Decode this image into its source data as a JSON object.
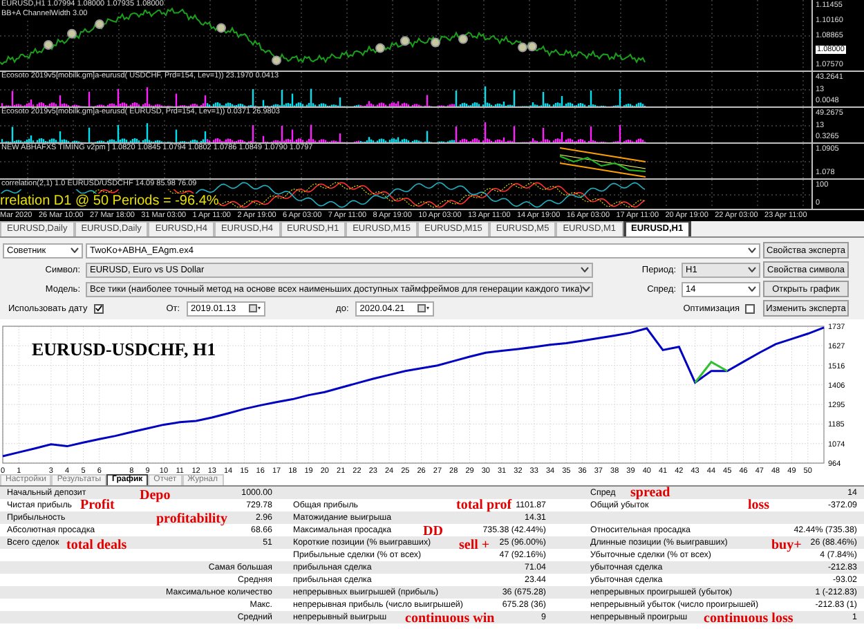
{
  "chart_window": {
    "panes": [
      {
        "kind": "price",
        "labels": [
          "EURUSD,H1  1.07994 1.08000 1.07935 1.08000",
          "BB+A ChannelWidth 3.00"
        ],
        "axis": [
          {
            "text": "1.11455",
            "kind": "tick"
          },
          {
            "text": "1.10160",
            "kind": "tick"
          },
          {
            "text": "1.08865",
            "kind": "tick"
          },
          {
            "text": "1.08000",
            "kind": "current"
          },
          {
            "text": "1.07570",
            "kind": "tick"
          }
        ]
      },
      {
        "kind": "histogram",
        "labels": [
          "Ecosoto 2019v5[mobilk.gm]a-eurusd( USDCHF, Prd=154, Lev=1)) 23.1970 0.0413"
        ],
        "axis": [
          {
            "text": "43.2641",
            "kind": "tick"
          },
          {
            "text": "13",
            "kind": "tick"
          },
          {
            "text": "0.0048",
            "kind": "tick"
          }
        ]
      },
      {
        "kind": "histogram_inverse",
        "labels": [
          "Ecosoto 2019v5[mobilk.gm]a-eurusd( EURUSD, Prd=154, Lev=1)) 0.0371 26.9803"
        ],
        "axis": [
          {
            "text": "49.2675",
            "kind": "tick"
          },
          {
            "text": "13",
            "kind": "tick"
          },
          {
            "text": "0.3265",
            "kind": "tick"
          }
        ]
      },
      {
        "kind": "channel",
        "labels": [
          "NEW ABHAFXS TIMING v2pm ]  1.0820 1.0845 1.0794 1.0802 1.0786 1.0849 1.0790 1.0797"
        ],
        "axis": [
          {
            "text": "1.0905",
            "kind": "tick"
          },
          {
            "text": "1.078",
            "kind": "tick"
          }
        ]
      },
      {
        "kind": "correlation",
        "labels": [
          "correlation(2,1) 1.0 EURUSD/USDCHF 14.09 85.98 76.09"
        ],
        "overlay": "rrelation D1 @ 50 Periods = -96.4%",
        "axis": [
          {
            "text": "100",
            "kind": "tick"
          },
          {
            "text": "0",
            "kind": "tick"
          }
        ]
      }
    ],
    "time_axis": [
      "Mar 2020",
      "26 Mar 10:00",
      "27 Mar 18:00",
      "31 Mar 03:00",
      "1 Apr 11:00",
      "2 Apr 19:00",
      "6 Apr 03:00",
      "7 Apr 11:00",
      "8 Apr 19:00",
      "10 Apr 03:00",
      "13 Apr 11:00",
      "14 Apr 19:00",
      "16 Apr 03:00",
      "17 Apr 11:00",
      "20 Apr 19:00",
      "22 Apr 03:00",
      "23 Apr 11:00"
    ]
  },
  "chart_tabs": [
    {
      "label": "EURUSD,Daily",
      "selected": false
    },
    {
      "label": "EURUSD,Daily",
      "selected": false
    },
    {
      "label": "EURUSD,H4",
      "selected": false
    },
    {
      "label": "EURUSD,H4",
      "selected": false
    },
    {
      "label": "EURUSD,H1",
      "selected": false
    },
    {
      "label": "EURUSD,M15",
      "selected": false
    },
    {
      "label": "EURUSD,M15",
      "selected": false
    },
    {
      "label": "EURUSD,M5",
      "selected": false
    },
    {
      "label": "EURUSD,M1",
      "selected": false
    },
    {
      "label": "EURUSD,H1",
      "selected": true
    }
  ],
  "tester": {
    "expert_type": "Советник",
    "expert": "TwoKo+ABHA_EAgm.ex4",
    "symbol_label": "Символ:",
    "symbol": "EURUSD, Euro vs US Dollar",
    "period_label": "Период:",
    "period": "H1",
    "model_label": "Модель:",
    "model": "Все тики (наиболее точный метод на основе всех наименьших доступных таймфреймов для генерации каждого тика)",
    "spread_label": "Спред:",
    "spread": "14",
    "use_date_label": "Использовать дату",
    "use_date": true,
    "from_label": "От:",
    "from": "2019.01.13",
    "to_label": "до:",
    "to": "2020.04.21",
    "optimization_label": "Оптимизация",
    "optimization": false,
    "buttons": [
      "Свойства эксперта",
      "Свойства символа",
      "Открыть график",
      "Изменить эксперта"
    ]
  },
  "equity_chart": {
    "chart_data": {
      "type": "line",
      "title": "EURUSD-USDCHF, H1",
      "x": [
        0,
        1,
        2,
        3,
        4,
        5,
        6,
        7,
        8,
        9,
        10,
        11,
        12,
        13,
        14,
        15,
        16,
        17,
        18,
        19,
        20,
        21,
        22,
        23,
        24,
        25,
        26,
        27,
        28,
        29,
        30,
        31,
        32,
        33,
        34,
        35,
        36,
        37,
        38,
        39,
        40,
        41,
        42,
        43,
        44,
        45,
        46,
        47,
        48,
        49,
        50,
        51
      ],
      "series": [
        {
          "color": "#0000c0",
          "values": [
            1003,
            1025,
            1047,
            1070,
            1059,
            1080,
            1100,
            1118,
            1140,
            1160,
            1181,
            1195,
            1202,
            1222,
            1245,
            1270,
            1290,
            1308,
            1325,
            1348,
            1365,
            1390,
            1415,
            1440,
            1462,
            1484,
            1500,
            1515,
            1540,
            1565,
            1588,
            1598,
            1608,
            1620,
            1632,
            1642,
            1655,
            1670,
            1685,
            1700,
            1725,
            1603,
            1621,
            1419,
            1484,
            1484,
            1536,
            1588,
            1636,
            1665,
            1695,
            1730
          ]
        },
        {
          "color": "#30c030",
          "values": [
            null,
            null,
            null,
            null,
            null,
            null,
            null,
            null,
            null,
            null,
            null,
            null,
            null,
            null,
            null,
            null,
            null,
            null,
            null,
            null,
            null,
            null,
            null,
            null,
            null,
            null,
            null,
            null,
            null,
            null,
            null,
            null,
            null,
            null,
            null,
            null,
            null,
            null,
            null,
            null,
            null,
            null,
            null,
            1419,
            1535,
            1484,
            null,
            null,
            null,
            null,
            null,
            null
          ]
        }
      ],
      "xticks": [
        0,
        1,
        3,
        4,
        5,
        6,
        8,
        9,
        10,
        11,
        12,
        13,
        14,
        15,
        16,
        17,
        18,
        19,
        20,
        21,
        22,
        23,
        24,
        25,
        26,
        27,
        28,
        29,
        30,
        31,
        32,
        33,
        34,
        35,
        36,
        37,
        38,
        39,
        40,
        41,
        42,
        43,
        44,
        45,
        46,
        47,
        48,
        49,
        50
      ],
      "yticks": [
        964,
        1074,
        1185,
        1295,
        1406,
        1516,
        1627,
        1737
      ],
      "grid": true,
      "ylim": [
        964,
        1737
      ],
      "xlim": [
        0,
        51
      ]
    }
  },
  "result_tabs": [
    {
      "label": "Настройки",
      "selected": false
    },
    {
      "label": "Результаты",
      "selected": false
    },
    {
      "label": "График",
      "selected": true
    },
    {
      "label": "Отчет",
      "selected": false
    },
    {
      "label": "Журнал",
      "selected": false
    }
  ],
  "report": {
    "rows": [
      {
        "col_1": "Начальный депозит",
        "col_2": "1000.00",
        "col_5": "Спред",
        "col_6": "14"
      },
      {
        "col_1": "Чистая прибыль",
        "col_2": "729.78",
        "col_3": "Общая прибыль",
        "col_4": "1101.87",
        "col_5": "Общий убыток",
        "col_6": "-372.09"
      },
      {
        "col_1": "Прибыльность",
        "col_2": "2.96",
        "col_3": "Матожидание выигрыша",
        "col_4": "14.31"
      },
      {
        "col_1": "Абсолютная просадка",
        "col_2": "68.66",
        "col_3": "Максимальная просадка",
        "col_4": "735.38 (42.44%)",
        "col_5": "Относительная просадка",
        "col_6": "42.44% (735.38)"
      },
      {
        "col_1": "Всего сделок",
        "col_2": "51",
        "col_3": "Короткие позиции (% выигравших)",
        "col_4": "25 (96.00%)",
        "col_5": "Длинные позиции (% выигравших)",
        "col_6": "26 (88.46%)"
      },
      {
        "col_3": "Прибыльные сделки (% от всех)",
        "col_4": "47 (92.16%)",
        "col_5": "Убыточные сделки (% от всех)",
        "col_6": "4 (7.84%)"
      },
      {
        "col_2": "Самая большая",
        "col_3": "прибыльная сделка",
        "col_4": "71.04",
        "col_5": "убыточная сделка",
        "col_6": "-212.83"
      },
      {
        "col_2": "Средняя",
        "col_3": "прибыльная сделка",
        "col_4": "23.44",
        "col_5": "убыточная сделка",
        "col_6": "-93.02"
      },
      {
        "col_2": "Максимальное количество",
        "col_3": "непрерывных выигрышей (прибыль)",
        "col_4": "36 (675.28)",
        "col_5": "непрерывных проигрышей (убыток)",
        "col_6": "1 (-212.83)"
      },
      {
        "col_2": "Макс.",
        "col_3": "непрерывная прибыль (число выигрышей)",
        "col_4": "675.28 (36)",
        "col_5": "непрерывный убыток (число проигрышей)",
        "col_6": "-212.83 (1)"
      },
      {
        "col_2": "Средний",
        "col_3": "непрерывный выигрыш",
        "col_4": "9",
        "col_5": "непрерывный проигрыш",
        "col_6": "1"
      }
    ],
    "annotations": [
      "Depo",
      "spread",
      "Profit",
      "total prof",
      "loss",
      "profitability",
      "DD",
      "total deals",
      "sell +",
      "buy+",
      "continuous win",
      "continuous loss"
    ]
  }
}
